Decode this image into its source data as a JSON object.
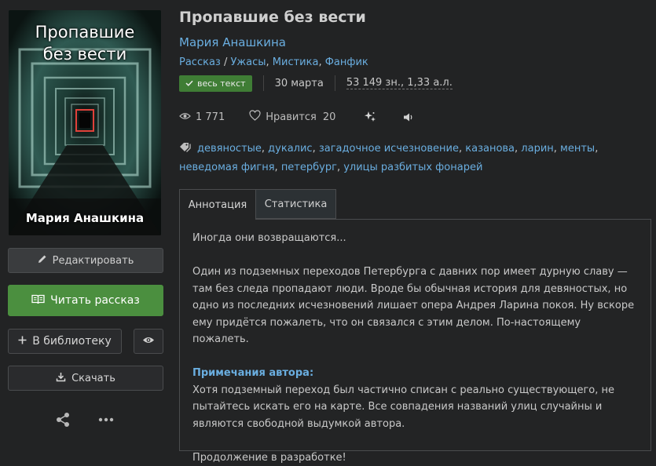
{
  "cover": {
    "title_line1": "Пропавшие",
    "title_line2": "без вести",
    "author": "Мария Анашкина"
  },
  "actions": {
    "edit": "Редактировать",
    "read": "Читать рассказ",
    "library": "В библиотеку",
    "download": "Скачать"
  },
  "book": {
    "title": "Пропавшие без вести",
    "author": "Мария Анашкина",
    "form": "Рассказ",
    "genre_sep": " / ",
    "genres": [
      "Ужасы",
      "Мистика",
      "Фанфик"
    ],
    "status_badge": "весь текст",
    "date": "30 марта",
    "size": "53 149 зн., 1,33 а.л."
  },
  "stats": {
    "views": "1 771",
    "likes_label": "Нравится",
    "likes": "20"
  },
  "tags": [
    "девяностые",
    "дукалис",
    "загадочное исчезновение",
    "казанова",
    "ларин",
    "менты",
    "неведомая фигня",
    "петербург",
    "улицы разбитых фонарей"
  ],
  "tabs": {
    "annotation": "Аннотация",
    "statistics": "Статистика"
  },
  "annotation": {
    "p1": "Иногда они возвращаются...",
    "p2": "Один из подземных переходов Петербурга с давних пор имеет дурную славу — там без следа пропадают люди. Вроде бы обычная история для девяностых, но одно из последних исчезновений лишает опера Андрея Ларина покоя. Ну вскоре ему придётся пожалеть, что он связался с этим делом. По-настоящему пожалеть.",
    "notes_title": "Примечания автора:",
    "notes": "Хотя подземный переход был частично списан с реально существующего, не пытай­тесь искать его на карте. Все совпадения названий улиц случайны и являются сво­бодной выдумкой автора.",
    "p4": "Продолжение в разработке!"
  },
  "colors": {
    "accent_link": "#6aaee0",
    "read_button": "#4b8f3f",
    "badge": "#3f7d35",
    "background": "#222324"
  }
}
